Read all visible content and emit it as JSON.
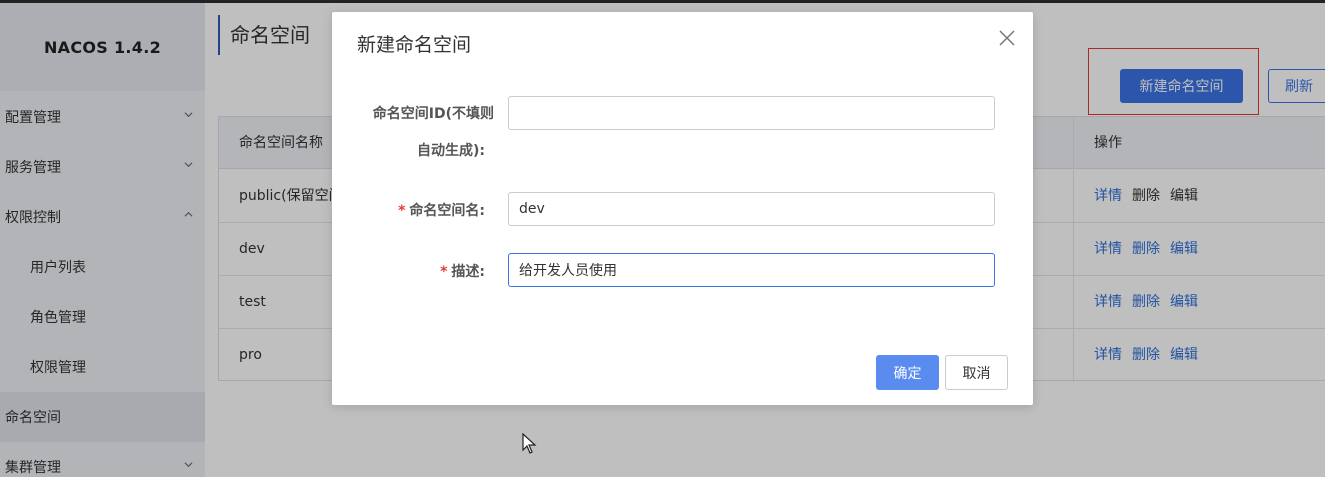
{
  "app": {
    "logo": "NACOS 1.4.2"
  },
  "sidebar": {
    "items": [
      {
        "label": "配置管理",
        "chevron": "down"
      },
      {
        "label": "服务管理",
        "chevron": "down"
      },
      {
        "label": "权限控制",
        "chevron": "up"
      },
      {
        "label": "用户列表"
      },
      {
        "label": "角色管理"
      },
      {
        "label": "权限管理"
      },
      {
        "label": "命名空间",
        "active": true
      },
      {
        "label": "集群管理",
        "chevron": "down"
      }
    ]
  },
  "main": {
    "title": "命名空间",
    "new_button": "新建命名空间",
    "refresh_button": "刷新"
  },
  "table": {
    "headers": {
      "name": "命名空间名称",
      "ops": "操作"
    },
    "rows": [
      {
        "name": "public(保留空间"
      },
      {
        "name": "dev"
      },
      {
        "name": "test"
      },
      {
        "name": "pro"
      }
    ],
    "ops": {
      "detail": "详情",
      "delete": "删除",
      "edit": "编辑"
    }
  },
  "dialog": {
    "title": "新建命名空间",
    "fields": {
      "id_label_line1": "命名空间ID(不填则",
      "id_label_line2": "自动生成):",
      "id_value": "",
      "name_required": "*",
      "name_label": "命名空间名:",
      "name_value": "dev",
      "desc_required": "*",
      "desc_label": "描述:",
      "desc_value": "给开发人员使用"
    },
    "ok_button": "确定",
    "cancel_button": "取消"
  },
  "colors": {
    "primary": "#3b73e6",
    "link": "#2e6fd8",
    "required": "#e53935",
    "highlight_box": "#e53935"
  }
}
